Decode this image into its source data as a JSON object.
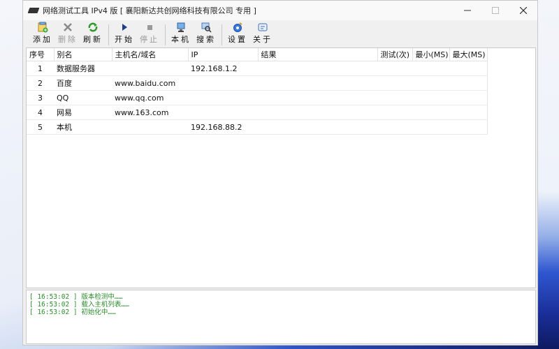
{
  "window": {
    "title": "网络测试工具 IPv4 版 [ 襄阳新达共创网络科技有限公司 专用 ]"
  },
  "toolbar": {
    "buttons": [
      {
        "label": "添加",
        "icon": "add-icon",
        "enabled": true
      },
      {
        "label": "删除",
        "icon": "delete-icon",
        "enabled": false
      },
      {
        "label": "刷新",
        "icon": "refresh-icon",
        "enabled": true
      },
      {
        "label": "开始",
        "icon": "play-icon",
        "enabled": true
      },
      {
        "label": "停止",
        "icon": "stop-icon",
        "enabled": false
      },
      {
        "label": "本机",
        "icon": "computer-icon",
        "enabled": true
      },
      {
        "label": "搜索",
        "icon": "search-icon",
        "enabled": true
      },
      {
        "label": "设置",
        "icon": "settings-icon",
        "enabled": true
      },
      {
        "label": "关于",
        "icon": "about-icon",
        "enabled": true
      }
    ]
  },
  "table": {
    "columns": [
      "序号",
      "别名",
      "主机名/域名",
      "IP",
      "结果",
      "测试(次)",
      "最小(MS)",
      "最大(MS)"
    ],
    "rows": [
      {
        "no": "1",
        "alias": "数据服务器",
        "host": "",
        "ip": "192.168.1.2",
        "result": "",
        "tests": "",
        "min": "",
        "max": ""
      },
      {
        "no": "2",
        "alias": "百度",
        "host": "www.baidu.com",
        "ip": "",
        "result": "",
        "tests": "",
        "min": "",
        "max": ""
      },
      {
        "no": "3",
        "alias": "QQ",
        "host": "www.qq.com",
        "ip": "",
        "result": "",
        "tests": "",
        "min": "",
        "max": ""
      },
      {
        "no": "4",
        "alias": "网易",
        "host": "www.163.com",
        "ip": "",
        "result": "",
        "tests": "",
        "min": "",
        "max": ""
      },
      {
        "no": "5",
        "alias": "本机",
        "host": "",
        "ip": "192.168.88.2",
        "result": "",
        "tests": "",
        "min": "",
        "max": ""
      }
    ]
  },
  "log": [
    "[ 16:53:02 ] 版本检测中……",
    "[ 16:53:02 ] 载入主机列表……",
    "[ 16:53:02 ] 初始化中……"
  ],
  "colors": {
    "log_text": "#2a8c2a",
    "accent": "#1f6fd1"
  }
}
